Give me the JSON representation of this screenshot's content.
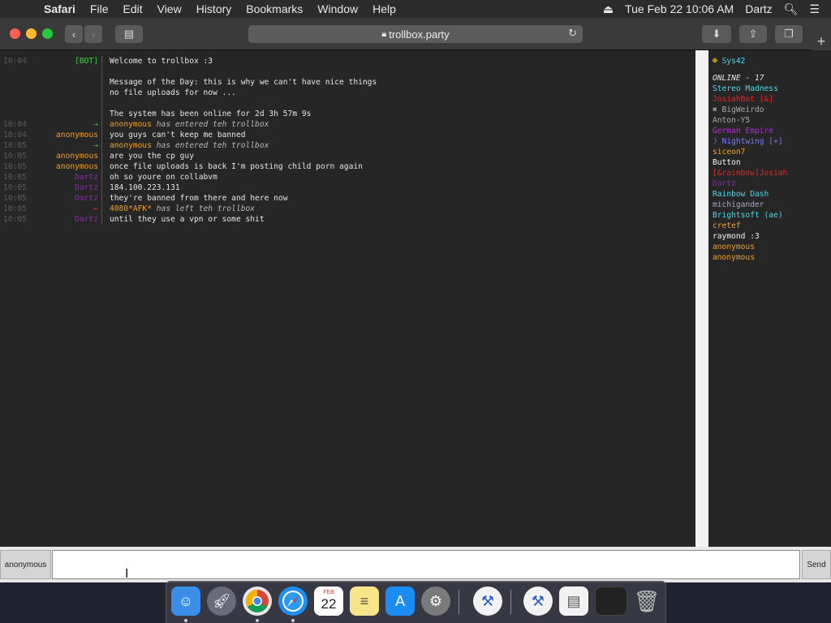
{
  "menubar": {
    "app": "Safari",
    "items": [
      "File",
      "Edit",
      "View",
      "History",
      "Bookmarks",
      "Window",
      "Help"
    ],
    "datetime": "Tue Feb 22  10:06 AM",
    "user": "Dartz"
  },
  "browser": {
    "url": "trollbox.party"
  },
  "messages": [
    {
      "time": "10:04",
      "nick": "[BOT]",
      "nick_color": "#3ad13a",
      "text": "Welcome to trollbox :3"
    },
    {
      "time": "",
      "nick": "",
      "nick_color": "#e6e6e6",
      "text": ""
    },
    {
      "time": "",
      "nick": "",
      "nick_color": "#e6e6e6",
      "text": "Message of the Day: this is why we can't have nice things"
    },
    {
      "time": "",
      "nick": "",
      "nick_color": "#e6e6e6",
      "text": "no file uploads for now ..."
    },
    {
      "time": "",
      "nick": "",
      "nick_color": "#e6e6e6",
      "text": ""
    },
    {
      "time": "",
      "nick": "",
      "nick_color": "#e6e6e6",
      "text": "The system has been online for 2d 3h 57m 9s"
    },
    {
      "time": "10:04",
      "nick": "→",
      "nick_color": "#3ad13a",
      "who": "anonymous",
      "who_color": "#f0a020",
      "verb": "has entered teh trollbox"
    },
    {
      "time": "10:04",
      "nick": "anonymous",
      "nick_color": "#f0a020",
      "text": "you guys can't keep me banned"
    },
    {
      "time": "10:05",
      "nick": "→",
      "nick_color": "#3ad13a",
      "who": "anonymous",
      "who_color": "#f0a020",
      "verb": "has entered teh trollbox"
    },
    {
      "time": "10:05",
      "nick": "anonymous",
      "nick_color": "#f0a020",
      "text": "are you the cp guy"
    },
    {
      "time": "10:05",
      "nick": "anonymous",
      "nick_color": "#f0a020",
      "text": "once file uploads is back I'm posting child porn again"
    },
    {
      "time": "10:05",
      "nick": "Dartz",
      "nick_color": "#8a2aa8",
      "text": "oh so youre on collabvm"
    },
    {
      "time": "10:05",
      "nick": "Dartz",
      "nick_color": "#8a2aa8",
      "text": "184.100.223.131"
    },
    {
      "time": "10:05",
      "nick": "Dartz",
      "nick_color": "#8a2aa8",
      "text": "they're banned from there and here now"
    },
    {
      "time": "10:05",
      "nick": "←",
      "nick_color": "#e03030",
      "who": "4080*AFK*",
      "who_color": "#f0a020",
      "verb": "has left teh trollbox"
    },
    {
      "time": "10:05",
      "nick": "Dartz",
      "nick_color": "#8a2aa8",
      "text": "until they use a vpn or some shit"
    }
  ],
  "userlist": {
    "top_user": "Sys42",
    "online_label": "ONLINE - 17",
    "users": [
      {
        "name": "Stereo Madness",
        "color": "#4ad8e8"
      },
      {
        "name": "JosiahBot [&]",
        "color": "#e02828"
      },
      {
        "name": "✖ BigWeirdo",
        "color": "#a8a8a8"
      },
      {
        "name": "Anton-Y5",
        "color": "#a8a8a8"
      },
      {
        "name": "German Empire",
        "color": "#b82ad8"
      },
      {
        "name": "☽ Nightwing [+]",
        "color": "#7878ff"
      },
      {
        "name": "siceon7",
        "color": "#f0a020"
      },
      {
        "name": "Button",
        "color": "#f2f2f2"
      },
      {
        "name": "[&rainbow]Josiah",
        "color": "#e02828"
      },
      {
        "name": "Dartz",
        "color": "#8a2aa8"
      },
      {
        "name": "Rainbow Dash",
        "color": "#4ad8e8"
      },
      {
        "name": "michigander",
        "color": "#a8a8c8"
      },
      {
        "name": "Brightsoft (ae)",
        "color": "#4ad8e8"
      },
      {
        "name": "cretef",
        "color": "#f0a020"
      },
      {
        "name": "raymond :3",
        "color": "#f2f2f2"
      },
      {
        "name": "anonymous",
        "color": "#f0a020"
      },
      {
        "name": "anonymous",
        "color": "#f0a020"
      }
    ]
  },
  "input": {
    "nick_button": "anonymous",
    "value": "",
    "send_label": "Send"
  },
  "dock": {
    "calendar_month": "FEB",
    "calendar_day": "22"
  },
  "colors": {
    "chat_bg": "#262626",
    "timestamp": "#5c5c5c",
    "bot_green": "#3ad13a"
  }
}
